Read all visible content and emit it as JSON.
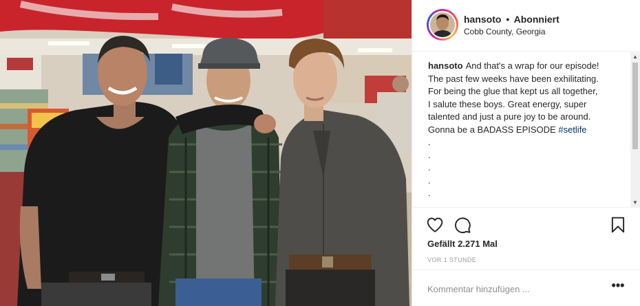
{
  "post": {
    "username": "hansoto",
    "separator": "•",
    "follow_status": "Abonniert",
    "location": "Cobb County, Georgia",
    "avatar_icon": "profile-photo",
    "photo_icon": "post-photo-three-men-in-store"
  },
  "caption": {
    "username": "hansoto",
    "lines": [
      "And that's a wrap for our episode!",
      "The past few weeks have been exhilitating.",
      "For being the glue that kept us all together,",
      "I salute these boys. Great energy, super",
      "talented and just a pure joy to be around.",
      "Gonna be a BADASS EPISODE"
    ],
    "hashtag": "#setlife",
    "dots": [
      ".",
      ".",
      ".",
      ".",
      ".",
      "."
    ]
  },
  "actions": {
    "like_icon": "heart-icon",
    "comment_icon": "speech-bubble-icon",
    "save_icon": "bookmark-icon"
  },
  "likes_text": "Gefällt 2.271 Mal",
  "time_text": "VOR 1 STUNDE",
  "comment": {
    "placeholder": "Kommentar hinzufügen ...",
    "more_label": "•••"
  },
  "colors": {
    "link": "#003569",
    "text": "#262626",
    "muted": "#999999",
    "border": "#efefef"
  }
}
